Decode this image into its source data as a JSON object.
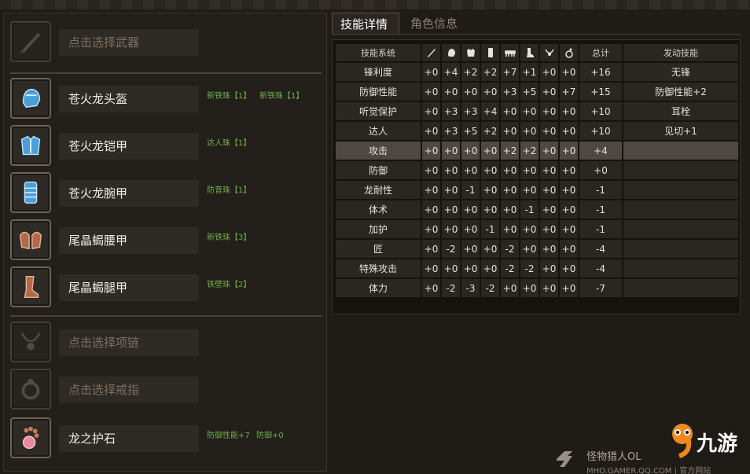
{
  "equipment": {
    "weapon": {
      "name": "点击选择武器",
      "jewels": []
    },
    "armor": [
      {
        "name": "苍火龙头盔",
        "icon": "helmet-icon",
        "jewels": [
          "新铁珠【1】",
          "新铁珠【1】"
        ]
      },
      {
        "name": "苍火龙铠甲",
        "icon": "chest-armor-icon",
        "jewels": [
          "达人珠【1】"
        ]
      },
      {
        "name": "苍火龙腕甲",
        "icon": "gauntlet-icon",
        "jewels": [
          "防音珠【1】"
        ]
      },
      {
        "name": "尾晶蝎腰甲",
        "icon": "waist-armor-icon",
        "jewels": [
          "新铁珠【3】"
        ]
      },
      {
        "name": "尾晶蝎腿甲",
        "icon": "leg-armor-icon",
        "jewels": [
          "铁壁珠【2】"
        ]
      }
    ],
    "necklace": {
      "name": "点击选择项链"
    },
    "ring": {
      "name": "点击选择戒指"
    },
    "talisman": {
      "name": "龙之护石",
      "jewels": [
        "防御性能+7",
        "防御+0"
      ]
    }
  },
  "tabs": [
    {
      "label": "技能详情",
      "active": true
    },
    {
      "label": "角色信息",
      "active": false
    }
  ],
  "skill_table": {
    "headers": {
      "name": "技能系统",
      "slots": [
        "weapon-icon",
        "helmet-icon",
        "chest-armor-icon",
        "gauntlet-icon",
        "waist-armor-icon",
        "leg-armor-icon",
        "necklace-icon",
        "talisman-icon"
      ],
      "total": "总计",
      "activated": "发动技能"
    },
    "rows": [
      {
        "name": "锋利度",
        "values": [
          "+0",
          "+4",
          "+2",
          "+2",
          "+7",
          "+1",
          "+0",
          "+0"
        ],
        "total": "+16",
        "activated": "无锋"
      },
      {
        "name": "防御性能",
        "values": [
          "+0",
          "+0",
          "+0",
          "+0",
          "+3",
          "+5",
          "+0",
          "+7"
        ],
        "total": "+15",
        "activated": "防御性能+2"
      },
      {
        "name": "听觉保护",
        "values": [
          "+0",
          "+3",
          "+3",
          "+4",
          "+0",
          "+0",
          "+0",
          "+0"
        ],
        "total": "+10",
        "activated": "耳栓"
      },
      {
        "name": "达人",
        "values": [
          "+0",
          "+3",
          "+5",
          "+2",
          "+0",
          "+0",
          "+0",
          "+0"
        ],
        "total": "+10",
        "activated": "见切+1"
      },
      {
        "name": "攻击",
        "values": [
          "+0",
          "+0",
          "+0",
          "+0",
          "+2",
          "+2",
          "+0",
          "+0"
        ],
        "total": "+4",
        "activated": "",
        "highlight": true
      },
      {
        "name": "防御",
        "values": [
          "+0",
          "+0",
          "+0",
          "+0",
          "+0",
          "+0",
          "+0",
          "+0"
        ],
        "total": "+0",
        "activated": ""
      },
      {
        "name": "龙耐性",
        "values": [
          "+0",
          "+0",
          "-1",
          "+0",
          "+0",
          "+0",
          "+0",
          "+0"
        ],
        "total": "-1",
        "activated": ""
      },
      {
        "name": "体术",
        "values": [
          "+0",
          "+0",
          "+0",
          "+0",
          "+0",
          "-1",
          "+0",
          "+0"
        ],
        "total": "-1",
        "activated": ""
      },
      {
        "name": "加护",
        "values": [
          "+0",
          "+0",
          "+0",
          "-1",
          "+0",
          "+0",
          "+0",
          "+0"
        ],
        "total": "-1",
        "activated": ""
      },
      {
        "name": "匠",
        "values": [
          "+0",
          "-2",
          "+0",
          "+0",
          "-2",
          "+0",
          "+0",
          "+0"
        ],
        "total": "-4",
        "activated": ""
      },
      {
        "name": "特殊攻击",
        "values": [
          "+0",
          "+0",
          "+0",
          "+0",
          "-2",
          "-2",
          "+0",
          "+0"
        ],
        "total": "-4",
        "activated": ""
      },
      {
        "name": "体力",
        "values": [
          "+0",
          "-2",
          "-3",
          "-2",
          "+0",
          "+0",
          "+0",
          "+0"
        ],
        "total": "-7",
        "activated": ""
      }
    ]
  },
  "watermark": {
    "site": "怪物猎人OL",
    "url": "MHO.GAMER.QQ.COM | 官方网站",
    "brand": "九游"
  }
}
